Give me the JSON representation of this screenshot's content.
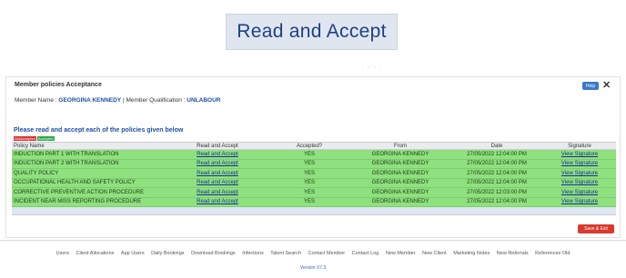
{
  "hero": {
    "label": "Read and Accept"
  },
  "ghost": "' ' ' '",
  "dialog": {
    "title": "Member policies Acceptance",
    "help_label": "Help",
    "close_label": "✕",
    "member_prefix": "Member Name : ",
    "member_name": "GEORGINA KENNEDY",
    "qual_prefix": " | Member Qualification : ",
    "qualification": "UNLABOUR",
    "instructions": "Please read and accept each of the policies given below",
    "legend": {
      "not_accepted": "NotAccepted",
      "accepted": "Accepted"
    },
    "columns": [
      "Policy Name",
      "Read and Accept",
      "Accepted?",
      "From",
      "Date",
      "Signature"
    ],
    "rows": [
      {
        "policy": "INDUCTION PART 1 WITH TRANSLATION",
        "action": "Read and Accept",
        "accepted": "YES",
        "from": "GEORGINA KENNEDY",
        "date": "27/05/2022 12:04:00 PM",
        "signature": "View Signature"
      },
      {
        "policy": "INDUCTION PART 2 WITH TRANSLATION",
        "action": "Read and Accept",
        "accepted": "YES",
        "from": "GEORGINA KENNEDY",
        "date": "27/05/2022 12:04:00 PM",
        "signature": "View Signature"
      },
      {
        "policy": "QUALITY POLICY",
        "action": "Read and Accept",
        "accepted": "YES",
        "from": "GEORGINA KENNEDY",
        "date": "27/05/2022 12:04:00 PM",
        "signature": "View Signature"
      },
      {
        "policy": "OCCUPATIONAL HEALTH AND SAFETY POLICY",
        "action": "Read and Accept",
        "accepted": "YES",
        "from": "GEORGINA KENNEDY",
        "date": "27/05/2022 12:04:00 PM",
        "signature": "View Signature"
      },
      {
        "policy": "CORRECTIVE PREVENTIVE ACTION PROCEDURE",
        "action": "Read and Accept",
        "accepted": "YES",
        "from": "GEORGINA KENNEDY",
        "date": "27/05/2022 12:03:00 PM",
        "signature": "View Signature"
      },
      {
        "policy": "INCIDENT NEAR MISS REPORTING PROCEDURE",
        "action": "Read and Accept",
        "accepted": "YES",
        "from": "GEORGINA KENNEDY",
        "date": "27/05/2022 12:04:00 PM",
        "signature": "View Signature"
      }
    ],
    "save_label": "Save & Exit"
  },
  "footer": {
    "links": [
      "Users",
      "Client Allocations",
      "App Users",
      "Daily Bookings",
      "Download Bookings",
      "Infections",
      "Talent Search",
      "Contact Member",
      "Contact Log",
      "New Member",
      "New Client",
      "Marketing Notes",
      "New Referrals",
      "References Old"
    ],
    "version": "Version X7.3"
  },
  "colors": {
    "accepted_row": "#8fe07e",
    "link": "#14309a",
    "save": "#d83a2e",
    "help": "#3b78c9"
  }
}
